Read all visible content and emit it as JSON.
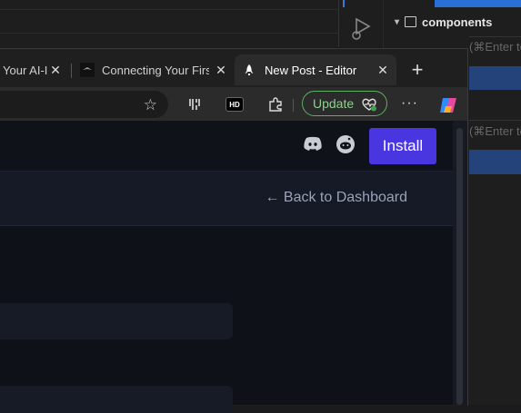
{
  "ide": {
    "explorer_section": "components",
    "command_hints": [
      "(⌘Enter to",
      "(⌘Enter to"
    ]
  },
  "browser": {
    "tabs": [
      {
        "title": "Your AI-I",
        "active": false
      },
      {
        "title": "Connecting Your Firs",
        "active": false
      },
      {
        "title": "New Post - Editor",
        "active": true
      }
    ],
    "new_tab_label": "+",
    "update_label": "Update",
    "more_label": "···",
    "hd_label": "HD"
  },
  "page": {
    "install_label": "Install",
    "back_link": "← Back to Dashboard"
  },
  "colors": {
    "accent": "#4a36e0",
    "update_green": "#8ed18f",
    "page_bg": "#0f1118"
  }
}
